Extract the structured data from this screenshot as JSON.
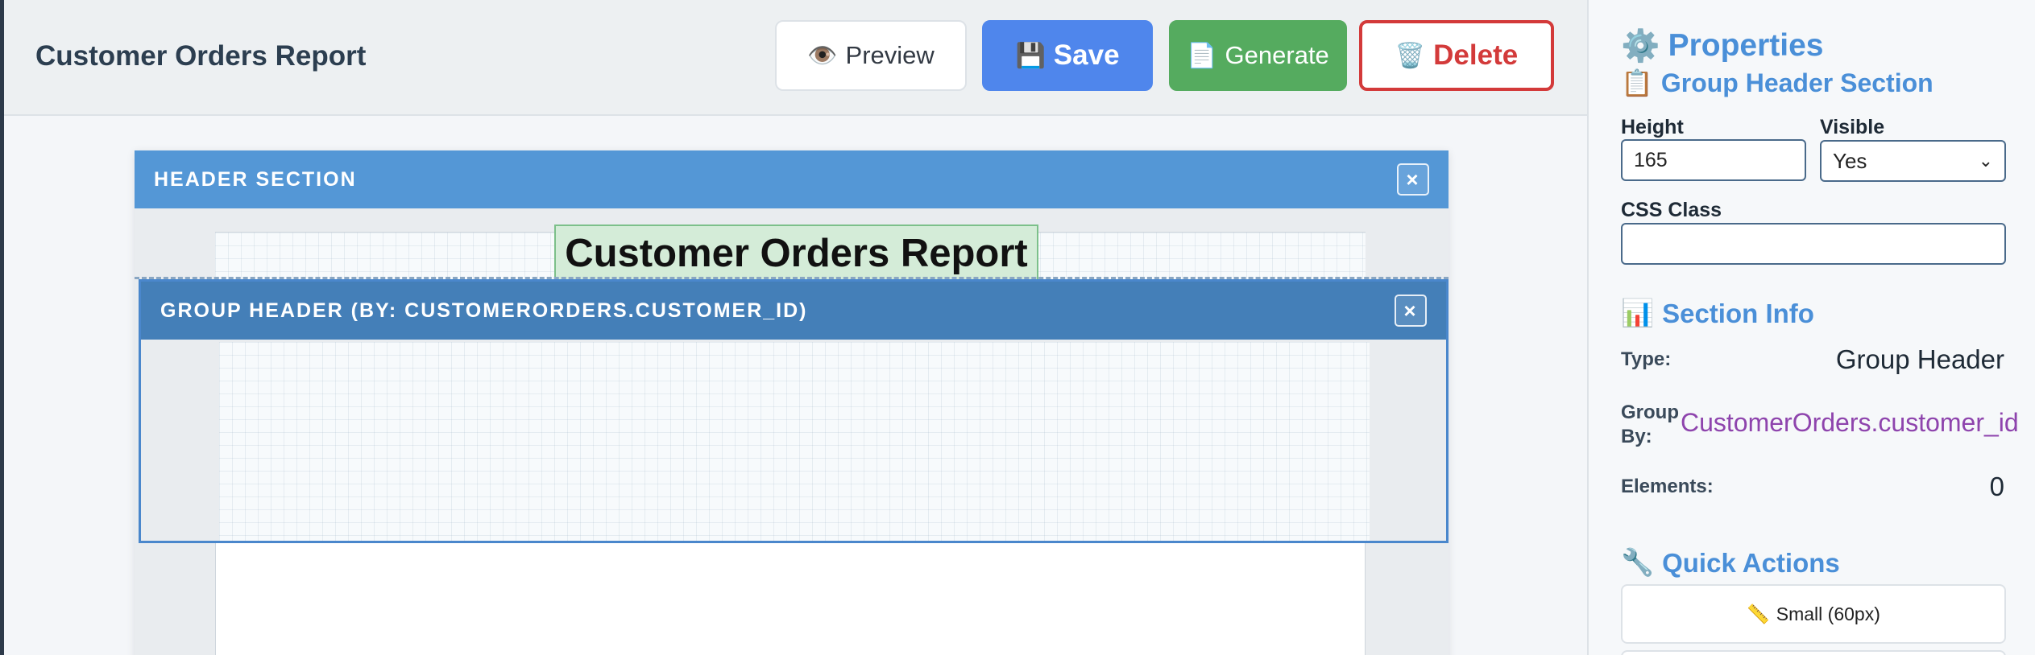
{
  "header": {
    "title": "Customer Orders Report",
    "buttons": {
      "preview_icon": "👁️",
      "preview": "Preview",
      "save_icon": "💾",
      "save": "Save",
      "generate_icon": "📄",
      "generate": "Generate",
      "delete_icon": "🗑️",
      "delete": "Delete"
    }
  },
  "canvas": {
    "header_section": {
      "label": "HEADER SECTION",
      "close": "×",
      "element_text": "Customer Orders Report"
    },
    "group_section": {
      "label": "GROUP HEADER (BY: CUSTOMERORDERS.CUSTOMER_ID)",
      "close": "×"
    }
  },
  "properties": {
    "title_icon": "⚙️",
    "title": "Properties",
    "subtitle_icon": "📋",
    "subtitle": "Group Header Section",
    "height_label": "Height",
    "height_value": "165",
    "visible_label": "Visible",
    "visible_value": "Yes",
    "css_label": "CSS Class",
    "css_value": "",
    "section_info_icon": "📊",
    "section_info_title": "Section Info",
    "info": {
      "type_label": "Type:",
      "type_value": "Group Header",
      "group_label_1": "Group",
      "group_label_2": "By:",
      "group_value": "CustomerOrders.customer_id",
      "elements_label": "Elements:",
      "elements_value": "0"
    },
    "quick_actions_icon": "🔧",
    "quick_actions_title": "Quick Actions",
    "qa_small_icon": "📏",
    "qa_small": "Small (60px)"
  },
  "colors": {
    "save": "#4f86ec",
    "generate": "#55ab5f",
    "delete": "#d33a3a",
    "header_section": "#5497d6",
    "group_section": "#447fb8",
    "accent": "#4a8fd8",
    "group_value": "#8e44ad"
  }
}
